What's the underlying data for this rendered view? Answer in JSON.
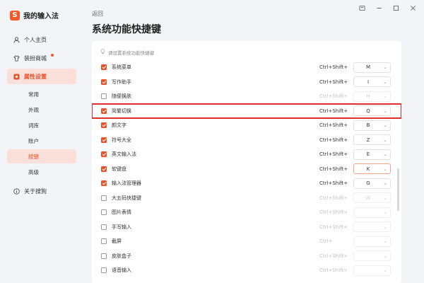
{
  "app": {
    "title": "我的输入法",
    "logo_letter": "S",
    "accent": "#e8532c"
  },
  "window_controls": [
    "pin-icon",
    "minimize-icon",
    "maximize-icon",
    "close-icon"
  ],
  "sidebar": {
    "items": [
      {
        "label": "个人主页",
        "icon": "user-icon"
      },
      {
        "label": "装扮商城",
        "icon": "shirt-icon"
      },
      {
        "label": "属性设置",
        "icon": "settings-icon"
      }
    ],
    "sub_items": [
      {
        "label": "常用"
      },
      {
        "label": "外观"
      },
      {
        "label": "词库"
      },
      {
        "label": "账户"
      },
      {
        "label": "按键"
      },
      {
        "label": "高级"
      }
    ],
    "about": {
      "label": "关于搜狗",
      "icon": "info-icon"
    }
  },
  "header": {
    "back": "返回",
    "title": "系统功能快捷键"
  },
  "hint": "请设置系统功能快捷键",
  "shortcuts": [
    {
      "label": "系统菜单",
      "checked": true,
      "combo": "Ctrl+Shift+",
      "key": "M"
    },
    {
      "label": "写作助手",
      "checked": true,
      "combo": "Ctrl+Shift+",
      "key": "I"
    },
    {
      "label": "随便换肤",
      "checked": false,
      "combo": "Ctrl+Shift+",
      "key": "H"
    },
    {
      "label": "简繁切换",
      "checked": true,
      "combo": "Ctrl+Shift+",
      "key": "Q"
    },
    {
      "label": "颜文字",
      "checked": true,
      "combo": "Ctrl+Shift+",
      "key": "B"
    },
    {
      "label": "符号大全",
      "checked": true,
      "combo": "Ctrl+Shift+",
      "key": "Z"
    },
    {
      "label": "英文输入法",
      "checked": true,
      "combo": "Ctrl+Shift+",
      "key": "E"
    },
    {
      "label": "软键盘",
      "checked": true,
      "combo": "Ctrl+Shift+",
      "key": "K"
    },
    {
      "label": "输入法管理器",
      "checked": true,
      "combo": "Ctrl+Shift+",
      "key": "G"
    },
    {
      "label": "大五码快捷键",
      "checked": false,
      "combo": "Ctrl+Shift+",
      "key": "W"
    },
    {
      "label": "图片表情",
      "checked": false,
      "combo": "Ctrl+Shift+",
      "key": ""
    },
    {
      "label": "手写输入",
      "checked": false,
      "combo": "Ctrl+Shift+",
      "key": ""
    },
    {
      "label": "截屏",
      "checked": false,
      "combo": "Ctrl+",
      "key": ""
    },
    {
      "label": "皮肤盒子",
      "checked": false,
      "combo": "Ctrl+Shift+",
      "key": ""
    },
    {
      "label": "语音输入",
      "checked": false,
      "combo": "Ctrl+Shift+",
      "key": ""
    }
  ]
}
